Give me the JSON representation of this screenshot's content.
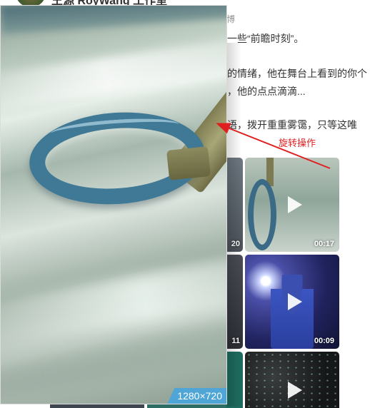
{
  "post": {
    "author": "王源 RoyWang 工作室",
    "meta_source": "博",
    "lines": [
      "一些“前瞻时刻”。",
      "的情绪，他在舞台上看到的你个",
      "，他的点点滴滴...",
      "语，拨开重重雾霭，只等这唯"
    ]
  },
  "thumbnails": [
    {
      "duration": "20"
    },
    {
      "duration": "00:17"
    },
    {
      "duration": "11"
    },
    {
      "duration": "00:09"
    }
  ],
  "preview": {
    "resolution": "1280×720"
  },
  "annotation": {
    "label": "旋转操作",
    "color": "#e02020"
  },
  "colors": {
    "badge": "#4fa6d6",
    "ring": "#3f7996"
  }
}
